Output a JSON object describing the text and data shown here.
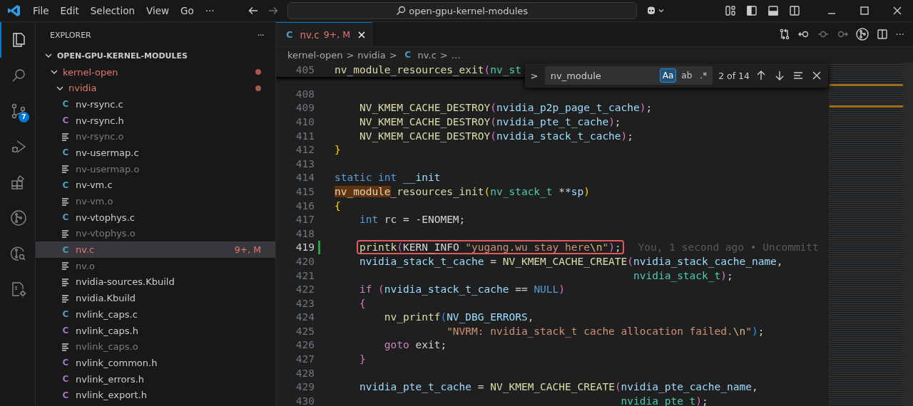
{
  "title_bar": {
    "menus": [
      "File",
      "Edit",
      "Selection",
      "View",
      "Go",
      "···"
    ],
    "search": "open-gpu-kernel-modules"
  },
  "activity_bar": [
    {
      "kind": "explorer",
      "selected": true
    },
    {
      "kind": "search",
      "selected": false
    },
    {
      "kind": "source-control",
      "selected": false,
      "badge": "7"
    },
    {
      "kind": "debug",
      "selected": false
    },
    {
      "kind": "extensions",
      "selected": false
    },
    {
      "kind": "git-graph",
      "selected": false
    },
    {
      "kind": "git-search",
      "selected": false
    },
    {
      "kind": "cpp-settings",
      "selected": false
    }
  ],
  "sidebar": {
    "title": "EXPLORER",
    "more": "···",
    "tree": [
      {
        "label": "OPEN-GPU-KERNEL-MODULES",
        "kind": "root",
        "expanded": true,
        "children": [
          {
            "label": "kernel-open",
            "kind": "folder",
            "expanded": true,
            "modified": true,
            "children": [
              {
                "label": "nvidia",
                "kind": "folder",
                "expanded": true,
                "modified": true,
                "children": [
                  {
                    "label": "nv-rsync.c",
                    "kind": "c",
                    "icon": "C",
                    "dimmed": false,
                    "selected": false,
                    "modified": false
                  },
                  {
                    "label": "nv-rsync.h",
                    "kind": "h",
                    "icon": "C",
                    "dimmed": false,
                    "selected": false,
                    "modified": false
                  },
                  {
                    "label": "nv-rsync.o",
                    "kind": "file",
                    "dimmed": true,
                    "selected": false,
                    "modified": false
                  },
                  {
                    "label": "nv-usermap.c",
                    "kind": "c",
                    "icon": "C",
                    "dimmed": false,
                    "selected": false,
                    "modified": false
                  },
                  {
                    "label": "nv-usermap.o",
                    "kind": "file",
                    "dimmed": true,
                    "selected": false,
                    "modified": false
                  },
                  {
                    "label": "nv-vm.c",
                    "kind": "c",
                    "icon": "C",
                    "dimmed": false,
                    "selected": false,
                    "modified": false
                  },
                  {
                    "label": "nv-vm.o",
                    "kind": "file",
                    "dimmed": true,
                    "selected": false,
                    "modified": false
                  },
                  {
                    "label": "nv-vtophys.c",
                    "kind": "c",
                    "icon": "C",
                    "dimmed": false,
                    "selected": false,
                    "modified": false
                  },
                  {
                    "label": "nv-vtophys.o",
                    "kind": "file",
                    "dimmed": true,
                    "selected": false,
                    "modified": false
                  },
                  {
                    "label": "nv.c",
                    "kind": "c",
                    "icon": "C",
                    "dimmed": false,
                    "selected": true,
                    "modified": true,
                    "badge": "9+, M"
                  },
                  {
                    "label": "nv.o",
                    "kind": "file",
                    "dimmed": true,
                    "selected": false,
                    "modified": false
                  },
                  {
                    "label": "nvidia-sources.Kbuild",
                    "kind": "file",
                    "dimmed": false,
                    "selected": false,
                    "modified": false
                  },
                  {
                    "label": "nvidia.Kbuild",
                    "kind": "file",
                    "dimmed": false,
                    "selected": false,
                    "modified": false
                  },
                  {
                    "label": "nvlink_caps.c",
                    "kind": "c",
                    "icon": "C",
                    "dimmed": false,
                    "selected": false,
                    "modified": false
                  },
                  {
                    "label": "nvlink_caps.h",
                    "kind": "h",
                    "icon": "C",
                    "dimmed": false,
                    "selected": false,
                    "modified": false
                  },
                  {
                    "label": "nvlink_caps.o",
                    "kind": "file",
                    "dimmed": true,
                    "selected": false,
                    "modified": false
                  },
                  {
                    "label": "nvlink_common.h",
                    "kind": "h",
                    "icon": "C",
                    "dimmed": false,
                    "selected": false,
                    "modified": false
                  },
                  {
                    "label": "nvlink_errors.h",
                    "kind": "h",
                    "icon": "C",
                    "dimmed": false,
                    "selected": false,
                    "modified": false
                  },
                  {
                    "label": "nvlink_export.h",
                    "kind": "h",
                    "icon": "C",
                    "dimmed": false,
                    "selected": false,
                    "modified": false
                  }
                ]
              }
            ]
          }
        ]
      }
    ]
  },
  "tabs": [
    {
      "label": "nv.c",
      "icon": "C",
      "badge": "9+, M",
      "selected": true,
      "modified": true
    }
  ],
  "breadcrumb": [
    {
      "text": "kernel-open",
      "kind": "text"
    },
    {
      "text": ">",
      "kind": "sep"
    },
    {
      "text": "nvidia",
      "kind": "text"
    },
    {
      "text": ">",
      "kind": "sep"
    },
    {
      "text": "C",
      "kind": "icon"
    },
    {
      "text": "nv.c",
      "kind": "text"
    },
    {
      "text": ">",
      "kind": "sep"
    },
    {
      "text": "…",
      "kind": "text"
    }
  ],
  "find_widget": {
    "toggle": ">",
    "value": "nv_module",
    "options": [
      {
        "text": "Aa",
        "selected": true
      },
      {
        "text": "ab",
        "selected": false
      },
      {
        "text": ".*",
        "selected": false
      }
    ],
    "result": "2 of 14"
  },
  "code": [
    {
      "number": "405",
      "current": false,
      "changed": false,
      "tokens": [
        {
          "text": "nv_module_resources_exit",
          "kind": "fn"
        },
        {
          "text": "(",
          "kind": "b2"
        },
        {
          "text": "nv_st",
          "kind": "type"
        }
      ]
    },
    {
      "number": "408",
      "current": false,
      "changed": false
    },
    {
      "number": "409",
      "current": false,
      "changed": false,
      "tokens": [
        {
          "text": "    NV_KMEM_CACHE_DESTROY",
          "kind": "fn"
        },
        {
          "text": "(",
          "kind": "b2"
        },
        {
          "text": "nvidia_p2p_page_t_cache",
          "kind": "var"
        },
        {
          "text": ")",
          "kind": "b2"
        },
        {
          "text": ";",
          "kind": "plain"
        }
      ]
    },
    {
      "number": "410",
      "current": false,
      "changed": false,
      "tokens": [
        {
          "text": "    NV_KMEM_CACHE_DESTROY",
          "kind": "fn"
        },
        {
          "text": "(",
          "kind": "b2"
        },
        {
          "text": "nvidia_pte_t_cache",
          "kind": "var"
        },
        {
          "text": ")",
          "kind": "b2"
        },
        {
          "text": ";",
          "kind": "plain"
        }
      ]
    },
    {
      "number": "411",
      "current": false,
      "changed": false,
      "tokens": [
        {
          "text": "    NV_KMEM_CACHE_DESTROY",
          "kind": "fn"
        },
        {
          "text": "(",
          "kind": "b2"
        },
        {
          "text": "nvidia_stack_t_cache",
          "kind": "var"
        },
        {
          "text": ")",
          "kind": "b2"
        },
        {
          "text": ";",
          "kind": "plain"
        }
      ]
    },
    {
      "number": "412",
      "current": false,
      "changed": false,
      "tokens": [
        {
          "text": "}",
          "kind": "b1"
        }
      ]
    },
    {
      "number": "413",
      "current": false,
      "changed": false
    },
    {
      "number": "414",
      "current": false,
      "changed": false,
      "tokens": [
        {
          "text": "static ",
          "kind": "kw"
        },
        {
          "text": "int ",
          "kind": "kw"
        },
        {
          "text": "__init",
          "kind": "var"
        }
      ]
    },
    {
      "number": "415",
      "current": false,
      "changed": false,
      "tokens": [
        {
          "text": "nv_module",
          "kind": "match"
        },
        {
          "text": "_resources_init",
          "kind": "fn"
        },
        {
          "text": "(",
          "kind": "b1"
        },
        {
          "text": "nv_stack_t",
          "kind": "type"
        },
        {
          "text": " **",
          "kind": "plain"
        },
        {
          "text": "sp",
          "kind": "var"
        },
        {
          "text": ")",
          "kind": "b1"
        }
      ]
    },
    {
      "number": "416",
      "current": false,
      "changed": false,
      "tokens": [
        {
          "text": "{",
          "kind": "b1"
        }
      ]
    },
    {
      "number": "417",
      "current": false,
      "changed": false,
      "tokens": [
        {
          "text": "    int",
          "kind": "kw"
        },
        {
          "text": " rc = -ENOMEM;",
          "kind": "plain"
        }
      ]
    },
    {
      "number": "418",
      "current": false,
      "changed": false
    },
    {
      "number": "419",
      "current": true,
      "changed": true,
      "boxed": true,
      "blame": "You, 1 second ago • Uncommitt",
      "tokens": [
        {
          "text": "    printk",
          "kind": "fn"
        },
        {
          "text": "(",
          "kind": "b2"
        },
        {
          "text": "KERN_INFO ",
          "kind": "plain"
        },
        {
          "text": "\"yugang.wu stay here",
          "kind": "str"
        },
        {
          "text": "\\n",
          "kind": "esc"
        },
        {
          "text": "\"",
          "kind": "str"
        },
        {
          "text": ")",
          "kind": "b2"
        },
        {
          "text": ";",
          "kind": "plain"
        }
      ]
    },
    {
      "number": "420",
      "current": false,
      "changed": false,
      "tokens": [
        {
          "text": "    nvidia_stack_t_cache",
          "kind": "var"
        },
        {
          "text": " = ",
          "kind": "plain"
        },
        {
          "text": "NV_KMEM_CACHE_CREATE",
          "kind": "fn"
        },
        {
          "text": "(",
          "kind": "b2"
        },
        {
          "text": "nvidia_stack_cache_name",
          "kind": "var"
        },
        {
          "text": ",",
          "kind": "plain"
        }
      ]
    },
    {
      "number": "421",
      "current": false,
      "changed": false,
      "tokens": [
        {
          "text": "                                                nvidia_stack_t",
          "kind": "type"
        },
        {
          "text": ")",
          "kind": "b2"
        },
        {
          "text": ";",
          "kind": "plain"
        }
      ]
    },
    {
      "number": "422",
      "current": false,
      "changed": false,
      "tokens": [
        {
          "text": "    if ",
          "kind": "ctrl"
        },
        {
          "text": "(",
          "kind": "b2"
        },
        {
          "text": "nvidia_stack_t_cache",
          "kind": "var"
        },
        {
          "text": " == ",
          "kind": "plain"
        },
        {
          "text": "NULL",
          "kind": "kw"
        },
        {
          "text": ")",
          "kind": "b2"
        }
      ]
    },
    {
      "number": "423",
      "current": false,
      "changed": false,
      "tokens": [
        {
          "text": "    {",
          "kind": "b2"
        }
      ]
    },
    {
      "number": "424",
      "current": false,
      "changed": false,
      "tokens": [
        {
          "text": "        nv_printf",
          "kind": "fn"
        },
        {
          "text": "(",
          "kind": "b3"
        },
        {
          "text": "NV_DBG_ERRORS",
          "kind": "var"
        },
        {
          "text": ",",
          "kind": "plain"
        }
      ]
    },
    {
      "number": "425",
      "current": false,
      "changed": false,
      "tokens": [
        {
          "text": "                  \"NVRM: nvidia_stack_t cache allocation failed.",
          "kind": "str"
        },
        {
          "text": "\\n",
          "kind": "esc"
        },
        {
          "text": "\"",
          "kind": "str"
        },
        {
          "text": ")",
          "kind": "b3"
        },
        {
          "text": ";",
          "kind": "plain"
        }
      ]
    },
    {
      "number": "426",
      "current": false,
      "changed": false,
      "tokens": [
        {
          "text": "        goto",
          "kind": "ctrl"
        },
        {
          "text": " exit;",
          "kind": "plain"
        }
      ]
    },
    {
      "number": "427",
      "current": false,
      "changed": false,
      "tokens": [
        {
          "text": "    }",
          "kind": "b2"
        }
      ]
    },
    {
      "number": "428",
      "current": false,
      "changed": false
    },
    {
      "number": "429",
      "current": false,
      "changed": false,
      "tokens": [
        {
          "text": "    nvidia_pte_t_cache",
          "kind": "var"
        },
        {
          "text": " = ",
          "kind": "plain"
        },
        {
          "text": "NV_KMEM_CACHE_CREATE",
          "kind": "fn"
        },
        {
          "text": "(",
          "kind": "b2"
        },
        {
          "text": "nvidia_pte_cache_name",
          "kind": "var"
        },
        {
          "text": ",",
          "kind": "plain"
        }
      ]
    },
    {
      "number": "430",
      "current": false,
      "changed": false,
      "tokens": [
        {
          "text": "                                              nvidia_pte_t",
          "kind": "type"
        },
        {
          "text": ")",
          "kind": "b2"
        },
        {
          "text": ";",
          "kind": "plain"
        }
      ]
    }
  ]
}
